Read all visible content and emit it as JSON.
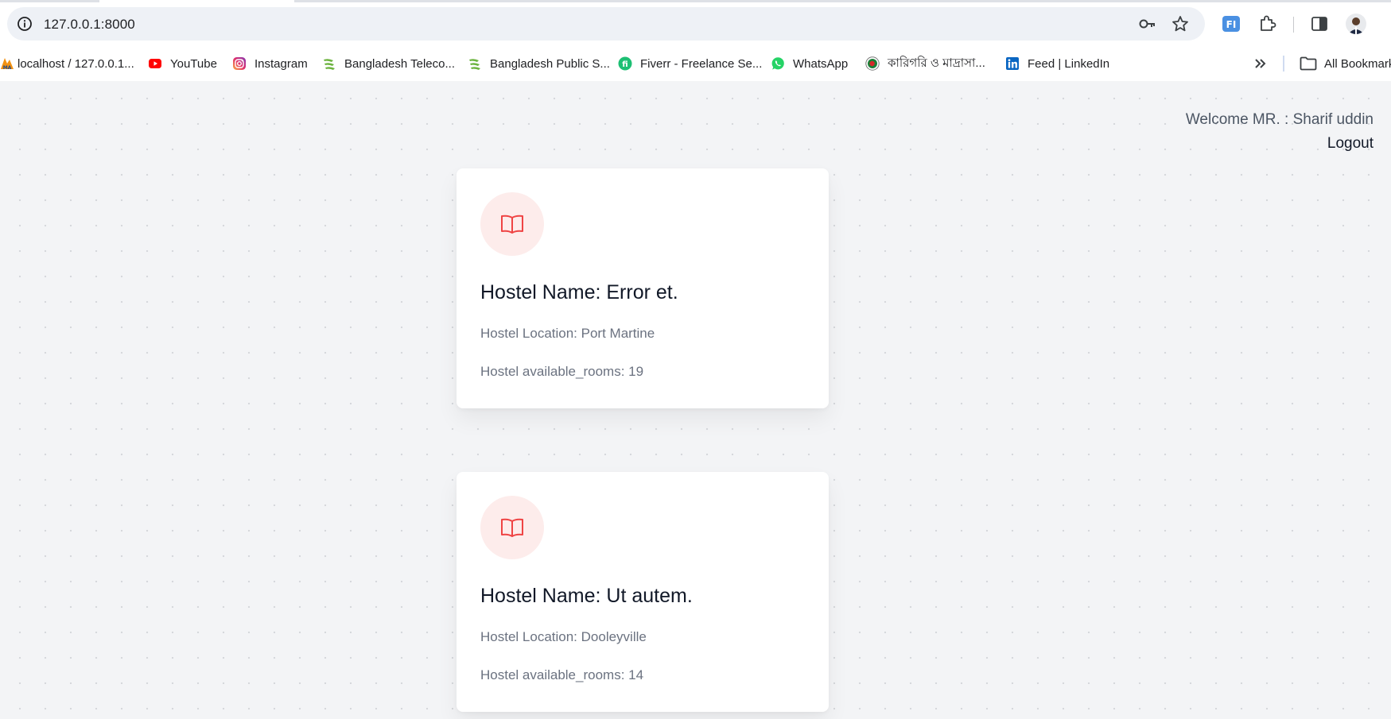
{
  "browser": {
    "url": "127.0.0.1:8000",
    "bookmarks": [
      {
        "label": "localhost / 127.0.0.1...",
        "icon": "phpmyadmin-icon"
      },
      {
        "label": "YouTube",
        "icon": "youtube-icon"
      },
      {
        "label": "Instagram",
        "icon": "instagram-icon"
      },
      {
        "label": "Bangladesh Teleco...",
        "icon": "btcl-icon"
      },
      {
        "label": "Bangladesh Public S...",
        "icon": "bpsc-icon"
      },
      {
        "label": "Fiverr - Freelance Se...",
        "icon": "fiverr-icon"
      },
      {
        "label": "WhatsApp",
        "icon": "whatsapp-icon"
      },
      {
        "label": "কারিগরি ও মাদ্রাসা...",
        "icon": "bd-gov-icon"
      },
      {
        "label": "Feed | LinkedIn",
        "icon": "linkedin-icon"
      }
    ],
    "all_bookmarks_label": "All Bookmarks"
  },
  "header": {
    "welcome_text": "Welcome MR. : Sharif uddin",
    "logout_label": "Logout"
  },
  "hostels": [
    {
      "name": "Hostel Name: Error et.",
      "location": "Hostel Location: Port Martine",
      "rooms": "Hostel available_rooms: 19"
    },
    {
      "name": "Hostel Name: Ut autem.",
      "location": "Hostel Location: Dooleyville",
      "rooms": "Hostel available_rooms: 14"
    }
  ],
  "colors": {
    "accent": "#ef4444",
    "icon_bg": "#fdeceb",
    "page_bg": "#f3f4f6"
  }
}
